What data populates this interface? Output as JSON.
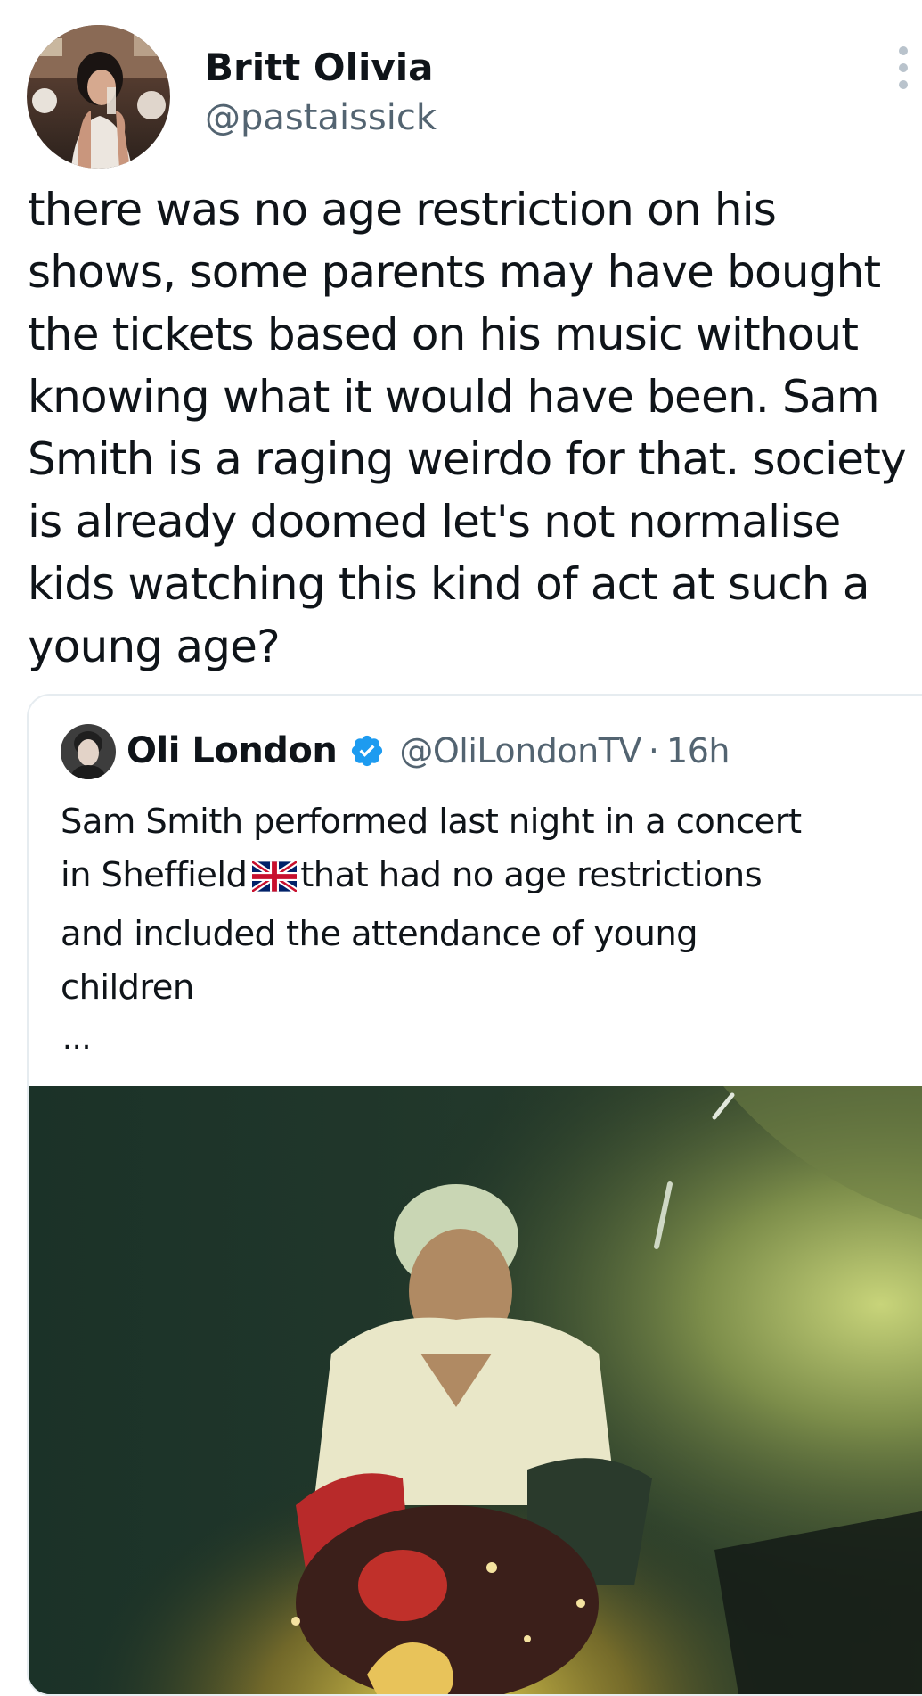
{
  "tweet": {
    "author": {
      "display_name": "Britt Olivia",
      "handle": "@pastaissick",
      "avatar_icon": "user-avatar-photo"
    },
    "more_icon": "more-vertical-icon",
    "text_lines": [
      "there was no age restriction on his",
      "shows, some parents may have bought",
      "the tickets based on his music without",
      "knowing what it would have been. Sam",
      "Smith is a raging weirdo for that. society",
      "is already doomed let's not normalise",
      "kids watching this kind of act at such a",
      "young age?"
    ]
  },
  "quote": {
    "author": {
      "display_name": "Oli London",
      "handle": "@OliLondonTV",
      "verified": true,
      "avatar_icon": "user-avatar-photo"
    },
    "separator": "·",
    "time": "16h",
    "text_lines": [
      "Sam Smith performed last night in a concert",
      "in Sheffield",
      "that had no age restrictions",
      "and included the attendance of young",
      "children"
    ],
    "flag_icon": "uk-flag-icon",
    "truncation": "...",
    "media_icon": "video-thumbnail"
  },
  "colors": {
    "text_primary": "#0f1419",
    "text_secondary": "#536471",
    "verified_blue": "#1d9bf0",
    "border": "#e6ecf0"
  }
}
